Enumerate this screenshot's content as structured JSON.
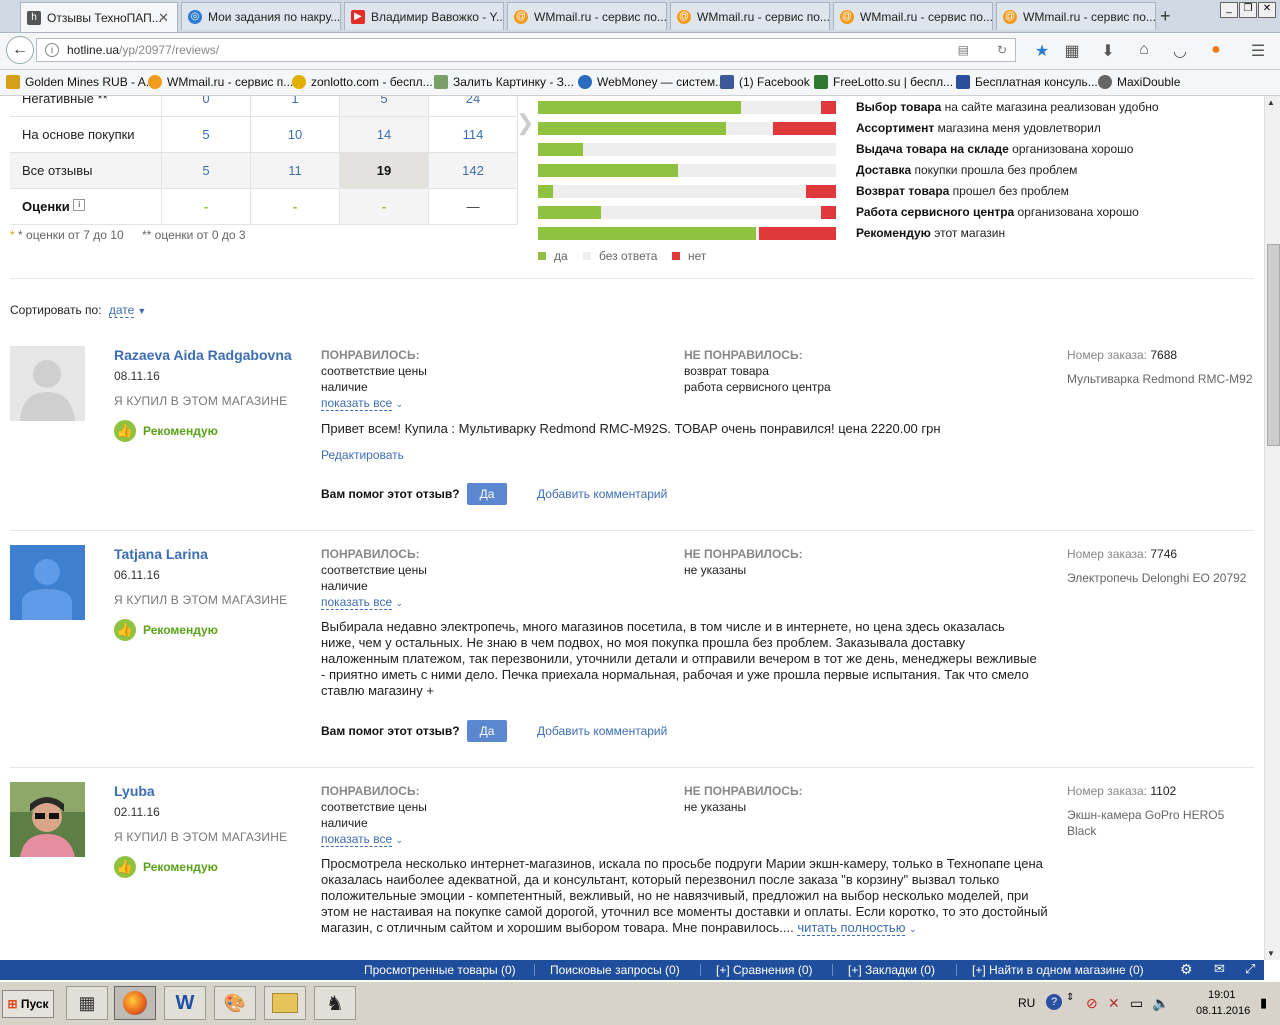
{
  "browser": {
    "tabs": [
      {
        "title": "Отзывы ТехноПАП...",
        "icon": "hotline-icon",
        "color": "#555555"
      },
      {
        "title": "Мои задания по накру...",
        "icon": "swirl-icon",
        "color": "#2a7bd6"
      },
      {
        "title": "Владимир Вавожко - Y...",
        "icon": "youtube-icon",
        "color": "#e52d27"
      },
      {
        "title": "WMmail.ru - сервис по...",
        "icon": "at-icon",
        "color": "#f29a1c"
      },
      {
        "title": "WMmail.ru - сервис по...",
        "icon": "at-icon",
        "color": "#f29a1c"
      },
      {
        "title": "WMmail.ru - сервис по...",
        "icon": "at-icon",
        "color": "#f29a1c"
      },
      {
        "title": "WMmail.ru - сервис по...",
        "icon": "at-icon",
        "color": "#f29a1c"
      }
    ],
    "url_host": "hotline.ua",
    "url_path": "/yp/20977/reviews/",
    "bookmarks": [
      "Golden Mines RUB - A...",
      "WMmail.ru - сервис п...",
      "zonlotto.com - беспл...",
      "Залить Картинку - З...",
      "WebMoney — систем...",
      "(1) Facebook",
      "FreeLotto.su | беспл...",
      "Бесплатная консуль...",
      "MaxiDouble"
    ]
  },
  "stats": {
    "rows": [
      {
        "label": "Негативные **",
        "values": [
          "0",
          "1",
          "5",
          "24"
        ]
      },
      {
        "label": "На основе покупки",
        "values": [
          "5",
          "10",
          "14",
          "114"
        ]
      },
      {
        "label": "Все отзывы",
        "values": [
          "5",
          "11",
          "19",
          "142"
        ]
      },
      {
        "label": "Оценки",
        "values": [
          "-",
          "-",
          "-",
          "—"
        ]
      }
    ],
    "footnote1": "* оценки от 7 до 10",
    "footnote2": "** оценки от 0 до 3"
  },
  "ratings": [
    {
      "bold": "Выбор товара",
      "rest": " на сайте магазина реализован удобно",
      "yes": 0.68,
      "no": 0.05
    },
    {
      "bold": "Ассортимент",
      "rest": " магазина меня удовлетворил",
      "yes": 0.63,
      "no": 0.21
    },
    {
      "bold": "Выдача товара на складе",
      "rest": " организована хорошо",
      "yes": 0.15,
      "no": 0.0
    },
    {
      "bold": "Доставка",
      "rest": " покупки прошла без проблем",
      "yes": 0.47,
      "no": 0.0
    },
    {
      "bold": "Возврат товара",
      "rest": " прошел без проблем",
      "yes": 0.05,
      "no": 0.1
    },
    {
      "bold": "Работа сервисного центра",
      "rest": " организована хорошо",
      "yes": 0.21,
      "no": 0.05
    },
    {
      "bold": "Рекомендую",
      "rest": " этот магазин",
      "yes": 0.73,
      "no": 0.26
    }
  ],
  "legend": {
    "yes": "да",
    "none": "без ответа",
    "no": "нет"
  },
  "sort": {
    "label": "Сортировать по:",
    "value": "дате"
  },
  "common": {
    "bought": "Я КУПИЛ В ЭТОМ МАГАЗИНЕ",
    "recommend": "Рекомендую",
    "liked": "ПОНРАВИЛОСЬ:",
    "disliked": "НЕ ПОНРАВИЛОСЬ:",
    "show_all": "показать все",
    "helped": "Вам помог этот отзыв?",
    "yes": "Да",
    "add_comment": "Добавить комментарий",
    "order_label": "Номер заказа:",
    "edit": "Редактировать"
  },
  "reviews": [
    {
      "name": "Razaeva Aida Radgabovna",
      "date": "08.11.16",
      "liked": [
        "соответствие цены",
        "наличие"
      ],
      "disliked": [
        "возврат товара",
        "работа сервисного центра"
      ],
      "text": "Привет всем! Купила : Мультиварку Redmond RMC-M92S. ТОВАР очень понравился! цена 2220.00 грн",
      "order": "7688",
      "product": "Мультиварка Redmond RMC-M92"
    },
    {
      "name": "Tatjana Larina",
      "date": "06.11.16",
      "liked": [
        "соответствие цены",
        "наличие"
      ],
      "disliked": [
        "не указаны"
      ],
      "text": "Выбирала недавно электропечь, много магазинов посетила, в том числе и в интернете, но цена здесь оказалась ниже, чем у остальных. Не знаю в чем подвох, но моя покупка прошла без проблем. Заказывала доставку наложенным платежом, так перезвонили, уточнили детали и отправили вечером в тот же день, менеджеры вежливые - приятно иметь с ними дело. Печка приехала нормальная, рабочая и уже прошла первые испытания. Так что смело ставлю магазину +",
      "order": "7746",
      "product": "Электропечь Delonghi EO 20792"
    },
    {
      "name": "Lyuba",
      "date": "02.11.16",
      "liked": [
        "соответствие цены",
        "наличие"
      ],
      "disliked": [
        "не указаны"
      ],
      "text": "Просмотрела несколько интернет-магазинов, искала по просьбе подруги Марии экшн-камеру, только в Технопапе цена оказалась наиболее адекватной, да и консультант, который перезвонил после заказа \"в корзину\" вызвал только положительные эмоции - компетентный, вежливый, но не навязчивый, предложил на выбор несколько моделей, при этом не настаивая на покупке самой дорогой, уточнил все моменты доставки и оплаты. Если коротко, то это достойный магазин, с отличным сайтом и хорошим выбором товара. Мне понравилось....",
      "read_more": "читать полностью",
      "order": "1102",
      "product": "Экшн-камера GoPro HERO5 Black"
    }
  ],
  "sitebar": [
    "Просмотренные товары (0)",
    "Поисковые запросы (0)",
    "[+]  Сравнения (0)",
    "[+]  Закладки (0)",
    "[+]  Найти в одном магазине (0)"
  ],
  "taskbar": {
    "start": "Пуск",
    "lang": "RU",
    "time": "19:01",
    "date": "08.11.2016"
  }
}
